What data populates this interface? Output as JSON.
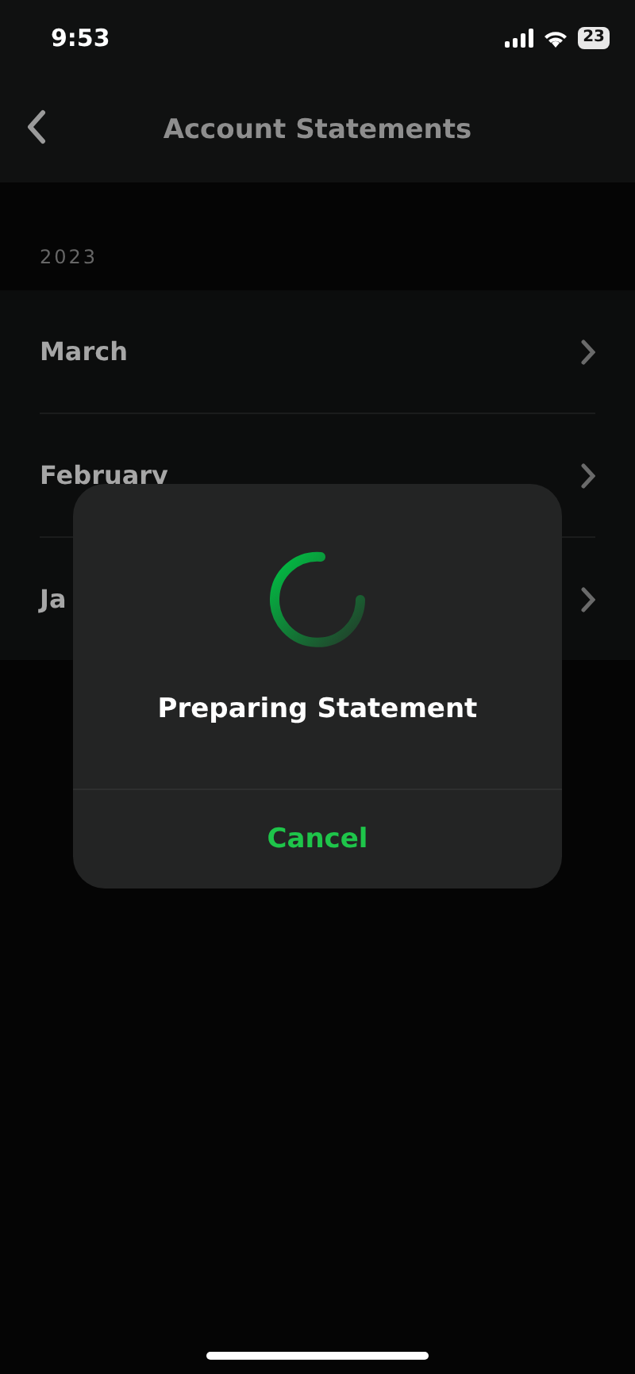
{
  "status_bar": {
    "time": "9:53",
    "battery": "23"
  },
  "header": {
    "title": "Account Statements"
  },
  "section": {
    "title": "2023"
  },
  "months": [
    {
      "label": "March"
    },
    {
      "label": "February"
    },
    {
      "label": "Ja"
    }
  ],
  "dialog": {
    "message": "Preparing Statement",
    "action": "Cancel"
  }
}
